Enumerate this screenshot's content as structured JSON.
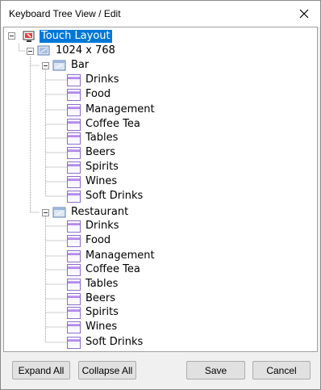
{
  "window": {
    "title": "Keyboard Tree View / Edit"
  },
  "icons": {
    "close": "close-icon",
    "touch_layout": "touch-screen-icon",
    "resolution": "monitor-resolution-icon",
    "group": "keyboard-group-icon",
    "keyboard": "keyboard-page-icon"
  },
  "tree": {
    "root_label": "Touch Layout",
    "resolution_label": "1024 x 768",
    "bar": {
      "label": "Bar",
      "children": [
        "Drinks",
        "Food",
        "Management",
        "Coffee Tea",
        "Tables",
        "Beers",
        "Spirits",
        "Wines",
        "Soft Drinks"
      ]
    },
    "restaurant": {
      "label": "Restaurant",
      "children": [
        "Drinks",
        "Food",
        "Management",
        "Coffee Tea",
        "Tables",
        "Beers",
        "Spirits",
        "Wines",
        "Soft Drinks"
      ]
    }
  },
  "buttons": {
    "expand_all": "Expand All",
    "collapse_all": "Collapse All",
    "save": "Save",
    "cancel": "Cancel"
  }
}
